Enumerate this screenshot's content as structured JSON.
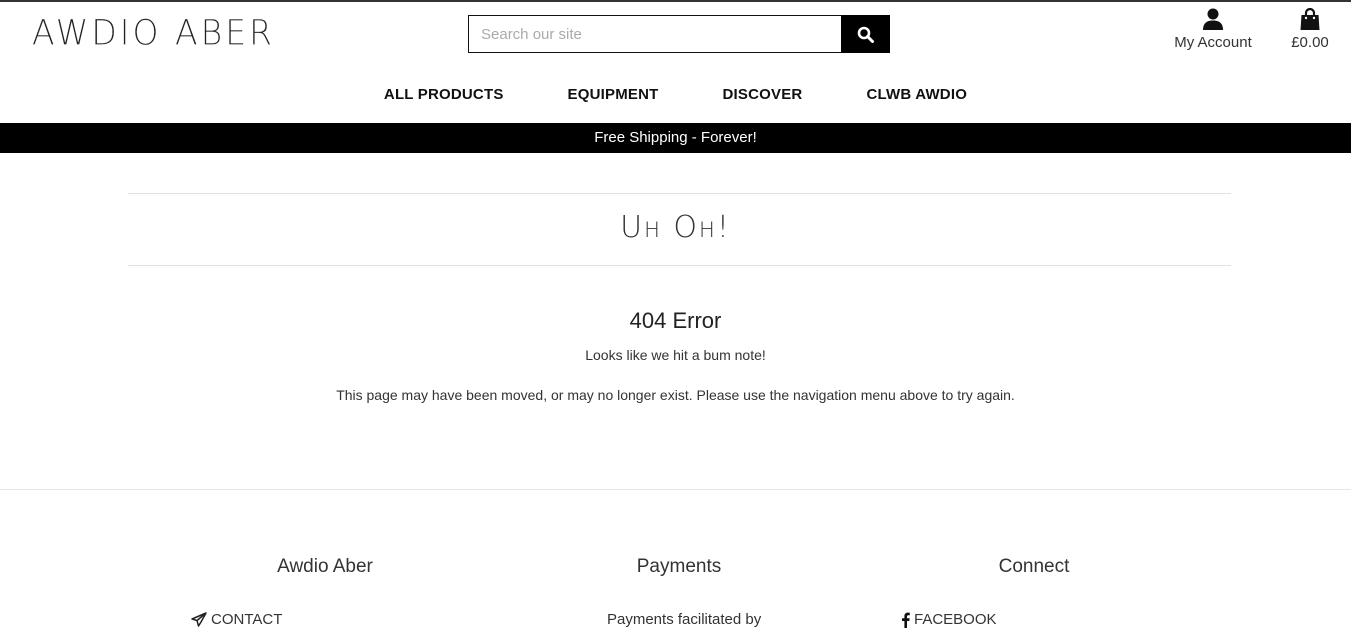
{
  "header": {
    "logo_text": "AWDIO ABER",
    "search": {
      "placeholder": "Search our site"
    },
    "account_label": "My Account",
    "cart_total": "£0.00"
  },
  "nav": {
    "items": [
      {
        "label": "ALL PRODUCTS"
      },
      {
        "label": "EQUIPMENT"
      },
      {
        "label": "DISCOVER"
      },
      {
        "label": "CLWB AWDIO"
      }
    ]
  },
  "banner": {
    "text": "Free Shipping - Forever!"
  },
  "main": {
    "title": "Uh Oh!",
    "error_heading": "404 Error",
    "message_1": "Looks like we hit a bum note!",
    "message_2": "This page may have been moved, or may no longer exist. Please use the navigation menu above to try again."
  },
  "footer": {
    "columns": [
      {
        "heading": "Awdio Aber",
        "link": "CONTACT"
      },
      {
        "heading": "Payments",
        "link": "Payments facilitated by"
      },
      {
        "heading": "Connect",
        "link": "FACEBOOK"
      }
    ]
  },
  "icons": {
    "search": "search-icon",
    "account": "user-icon",
    "cart": "shopping-bag-icon",
    "contact": "paper-plane-icon",
    "facebook": "facebook-icon"
  }
}
